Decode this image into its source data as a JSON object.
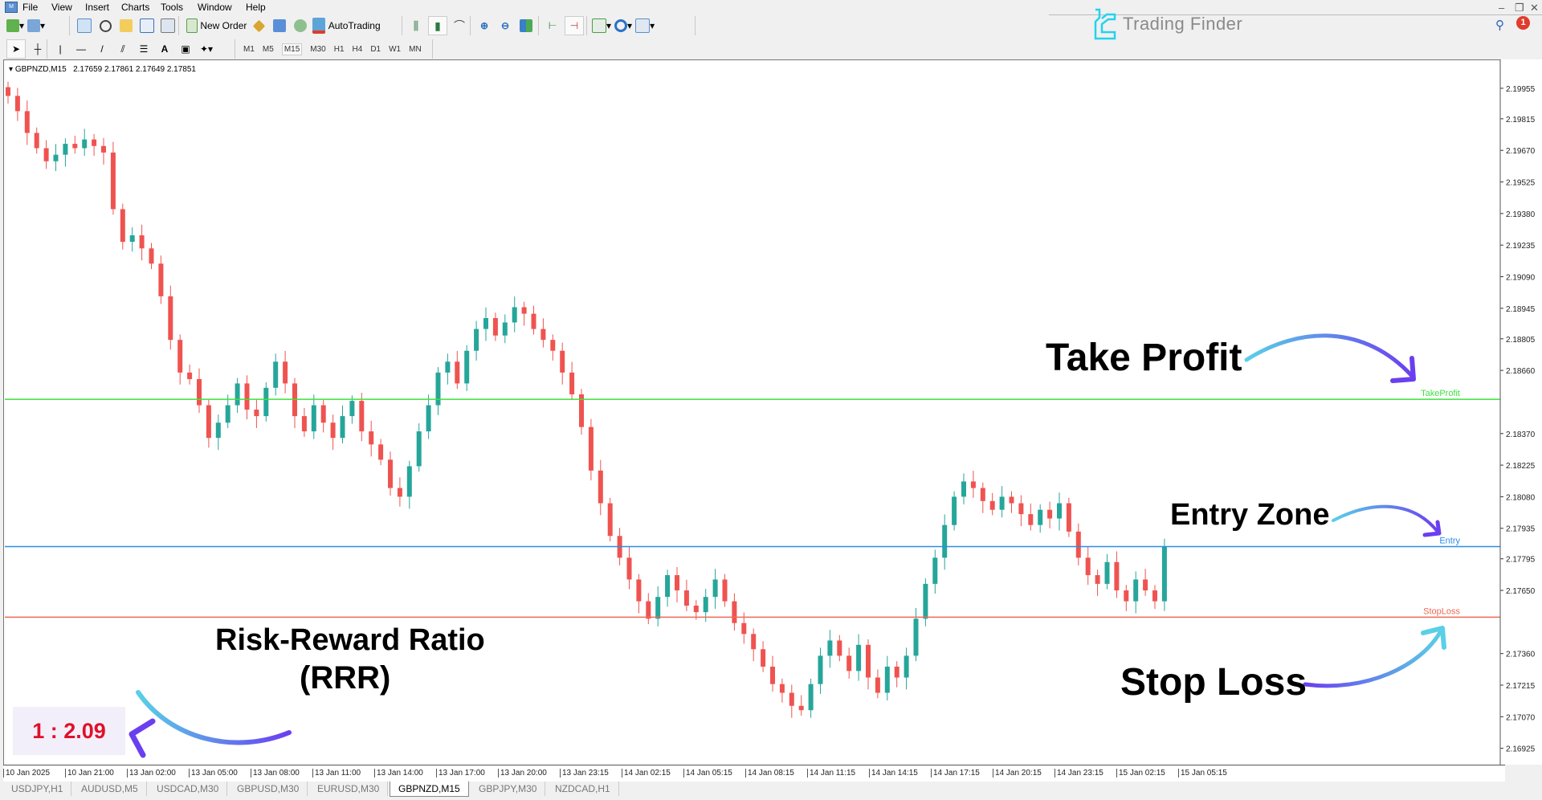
{
  "menu": {
    "items": [
      "File",
      "View",
      "Insert",
      "Charts",
      "Tools",
      "Window",
      "Help"
    ]
  },
  "toolbar": {
    "new_order_label": "New Order",
    "autotrading_label": "AutoTrading",
    "timeframes": [
      "M1",
      "M5",
      "M15",
      "M30",
      "H1",
      "H4",
      "D1",
      "W1",
      "MN"
    ],
    "active_timeframe": "M15"
  },
  "brand": {
    "name": "Trading Finder",
    "accent": "#22d3ee"
  },
  "notifications": {
    "count": "1"
  },
  "chart_header": {
    "symbol": "GBPNZD,M15",
    "ohlc": "2.17659 2.17861 2.17649 2.17851"
  },
  "tabs": [
    "USDJPY,H1",
    "AUDUSD,M5",
    "USDCAD,M30",
    "GBPUSD,M30",
    "EURUSD,M30",
    "GBPNZD,M15",
    "GBPJPY,M30",
    "NZDCAD,H1"
  ],
  "active_tab": "GBPNZD,M15",
  "annotations": {
    "take_profit": "Take Profit",
    "entry_zone": "Entry Zone",
    "stop_loss": "Stop Loss",
    "rrr_title": "Risk-Reward Ratio",
    "rrr_sub": "(RRR)",
    "rrr_value": "1 : 2.09"
  },
  "chart_data": {
    "type": "candlestick",
    "title": "GBPNZD,M15",
    "ylim": [
      2.1685,
      2.2008
    ],
    "y_ticks": [
      "2.19955",
      "2.19815",
      "2.19670",
      "2.19525",
      "2.19380",
      "2.19235",
      "2.19090",
      "2.18945",
      "2.18805",
      "2.18660",
      "2.18370",
      "2.18225",
      "2.18080",
      "2.17935",
      "2.17795",
      "2.17650",
      "2.17360",
      "2.17215",
      "2.17070",
      "2.16925"
    ],
    "x_ticks": [
      "10 Jan 2025",
      "10 Jan 21:00",
      "13 Jan 02:00",
      "13 Jan 05:00",
      "13 Jan 08:00",
      "13 Jan 11:00",
      "13 Jan 14:00",
      "13 Jan 17:00",
      "13 Jan 20:00",
      "13 Jan 23:15",
      "14 Jan 02:15",
      "14 Jan 05:15",
      "14 Jan 08:15",
      "14 Jan 11:15",
      "14 Jan 14:15",
      "14 Jan 17:15",
      "14 Jan 20:15",
      "14 Jan 23:15",
      "15 Jan 02:15",
      "15 Jan 05:15"
    ],
    "levels": [
      {
        "name": "TakeProfit",
        "value": 2.18527,
        "label": "2.18527",
        "color": "#3fe03f"
      },
      {
        "name": "Entry",
        "value": 2.17851,
        "label": "2.17851",
        "color": "#2b8ee8"
      },
      {
        "name": "StopLoss",
        "value": 2.17527,
        "label": "2.17527",
        "color": "#ec6a55"
      }
    ],
    "colors": {
      "bull": "#26a69a",
      "bear": "#ef5350"
    },
    "close_path": [
      2.1992,
      2.1985,
      2.1975,
      2.1968,
      2.1962,
      2.1965,
      2.197,
      2.1968,
      2.1972,
      2.1969,
      2.1966,
      2.194,
      2.1925,
      2.1928,
      2.1922,
      2.1915,
      2.19,
      2.188,
      2.1865,
      2.1862,
      2.185,
      2.1835,
      2.1842,
      2.185,
      2.186,
      2.1848,
      2.1845,
      2.1858,
      2.187,
      2.186,
      2.1845,
      2.1838,
      2.185,
      2.1842,
      2.1835,
      2.1845,
      2.1852,
      2.1838,
      2.1832,
      2.1825,
      2.1812,
      2.1808,
      2.1822,
      2.1838,
      2.185,
      2.1865,
      2.187,
      2.186,
      2.1875,
      2.1885,
      2.189,
      2.1882,
      2.1888,
      2.1895,
      2.1892,
      2.1885,
      2.188,
      2.1875,
      2.1865,
      2.1855,
      2.184,
      2.182,
      2.1805,
      2.179,
      2.178,
      2.177,
      2.176,
      2.1752,
      2.1762,
      2.1772,
      2.1765,
      2.1758,
      2.1755,
      2.1762,
      2.177,
      2.176,
      2.175,
      2.1745,
      2.1738,
      2.173,
      2.1722,
      2.1718,
      2.1712,
      2.171,
      2.1722,
      2.1735,
      2.1742,
      2.1735,
      2.1728,
      2.174,
      2.1725,
      2.1718,
      2.173,
      2.1725,
      2.1735,
      2.1752,
      2.1768,
      2.178,
      2.1795,
      2.1808,
      2.1815,
      2.1812,
      2.1806,
      2.1802,
      2.1808,
      2.1805,
      2.18,
      2.1795,
      2.1802,
      2.1798,
      2.1805,
      2.1792,
      2.178,
      2.1772,
      2.1768,
      2.1778,
      2.1765,
      2.176,
      2.177,
      2.1765,
      2.176,
      2.1785
    ]
  }
}
